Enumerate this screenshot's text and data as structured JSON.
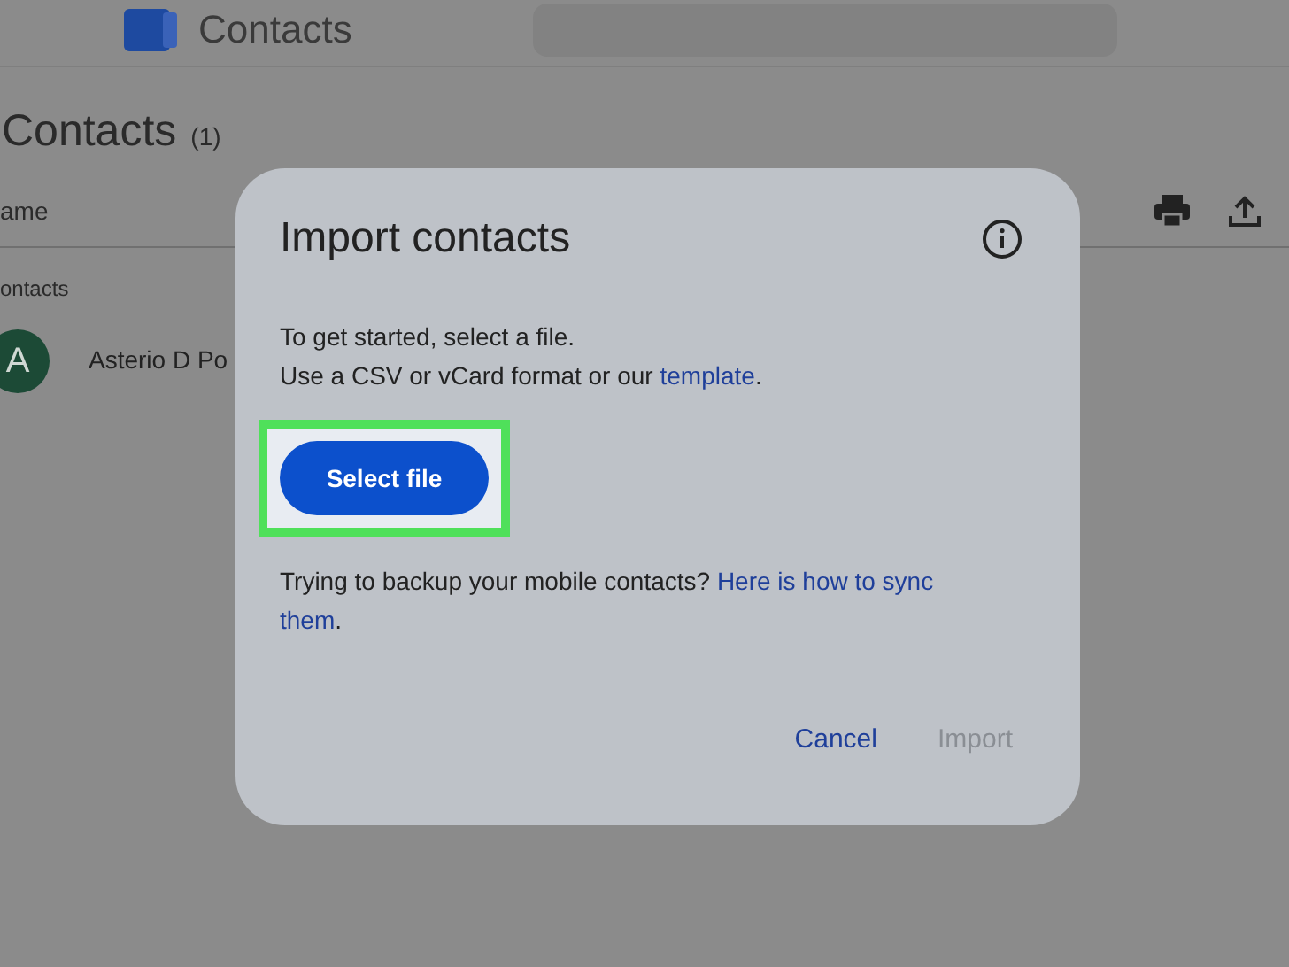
{
  "app_bar": {
    "title": "Contacts"
  },
  "page": {
    "heading": "Contacts",
    "count": "(1)",
    "column_header": "ame",
    "section_label": "ontacts",
    "contacts": [
      {
        "initial": "A",
        "name": "Asterio D Po"
      }
    ]
  },
  "dialog": {
    "title": "Import contacts",
    "lines": [
      "To get started, select a file.",
      "Use a CSV or vCard format or our "
    ],
    "template_link": "template",
    "period": ".",
    "select_button": "Select file",
    "highlighted": true,
    "backup_text": "Trying to backup your mobile contacts? ",
    "sync_link_lines": [
      "Here is how to sync",
      "them"
    ],
    "sync_period": ".",
    "buttons": [
      {
        "label": "Cancel",
        "disabled": false
      },
      {
        "label": "Import",
        "disabled": true
      }
    ]
  }
}
